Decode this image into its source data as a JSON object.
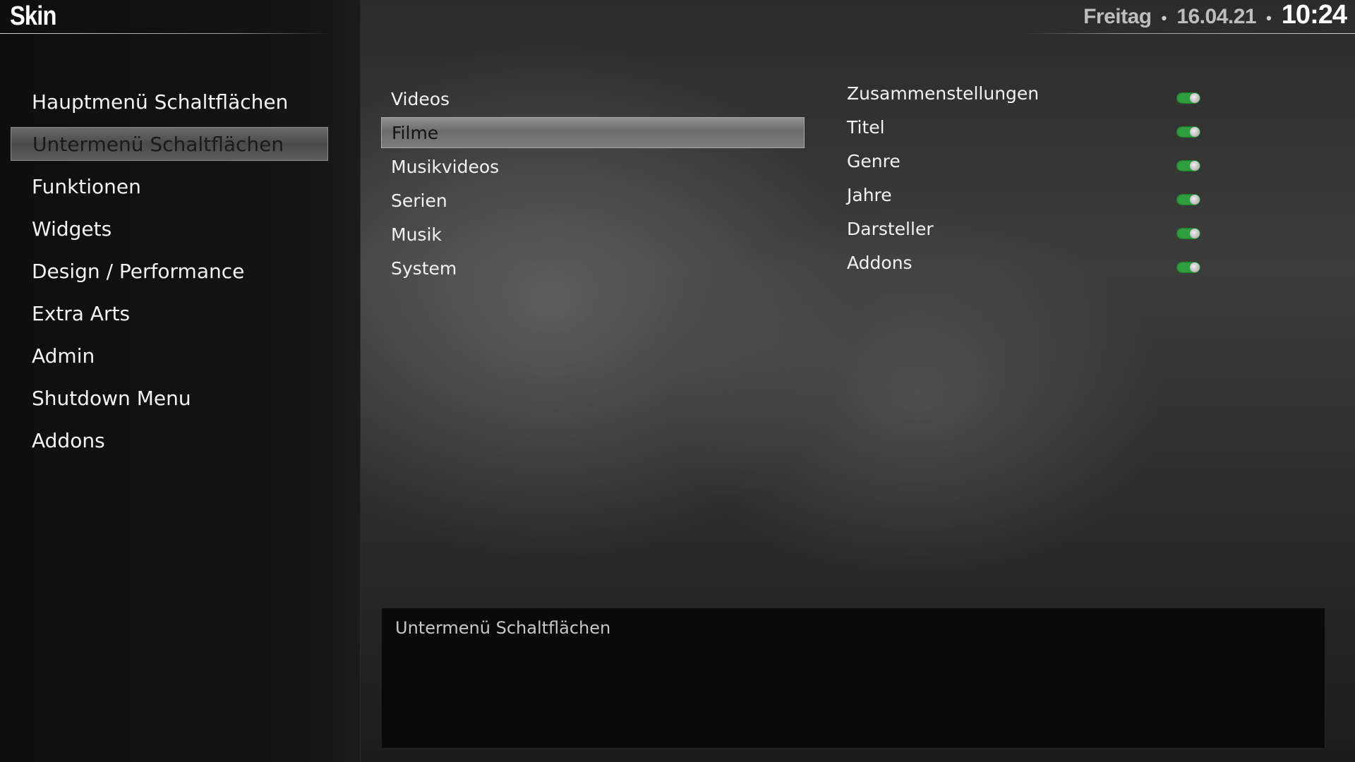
{
  "header": {
    "title": "Skin",
    "day": "Freitag",
    "date": "16.04.21",
    "time": "10:24",
    "separator": "•"
  },
  "sidebar": {
    "items": [
      {
        "label": "Hauptmenü Schaltflächen",
        "selected": false
      },
      {
        "label": "Untermenü Schaltflächen",
        "selected": true
      },
      {
        "label": "Funktionen",
        "selected": false
      },
      {
        "label": "Widgets",
        "selected": false
      },
      {
        "label": "Design / Performance",
        "selected": false
      },
      {
        "label": "Extra Arts",
        "selected": false
      },
      {
        "label": "Admin",
        "selected": false
      },
      {
        "label": "Shutdown Menu",
        "selected": false
      },
      {
        "label": "Addons",
        "selected": false
      }
    ]
  },
  "submenu": {
    "items": [
      {
        "label": "Videos",
        "selected": false
      },
      {
        "label": "Filme",
        "selected": true
      },
      {
        "label": "Musikvideos",
        "selected": false
      },
      {
        "label": "Serien",
        "selected": false
      },
      {
        "label": "Musik",
        "selected": false
      },
      {
        "label": "System",
        "selected": false
      }
    ]
  },
  "options": {
    "items": [
      {
        "label": "Zusammenstellungen",
        "enabled": true
      },
      {
        "label": "Titel",
        "enabled": true
      },
      {
        "label": "Genre",
        "enabled": true
      },
      {
        "label": "Jahre",
        "enabled": true
      },
      {
        "label": "Darsteller",
        "enabled": true
      },
      {
        "label": "Addons",
        "enabled": true
      }
    ]
  },
  "description": {
    "text": "Untermenü Schaltflächen"
  },
  "colors": {
    "toggle_on": "#2f9e3c",
    "selection": "#6a6a6a"
  }
}
